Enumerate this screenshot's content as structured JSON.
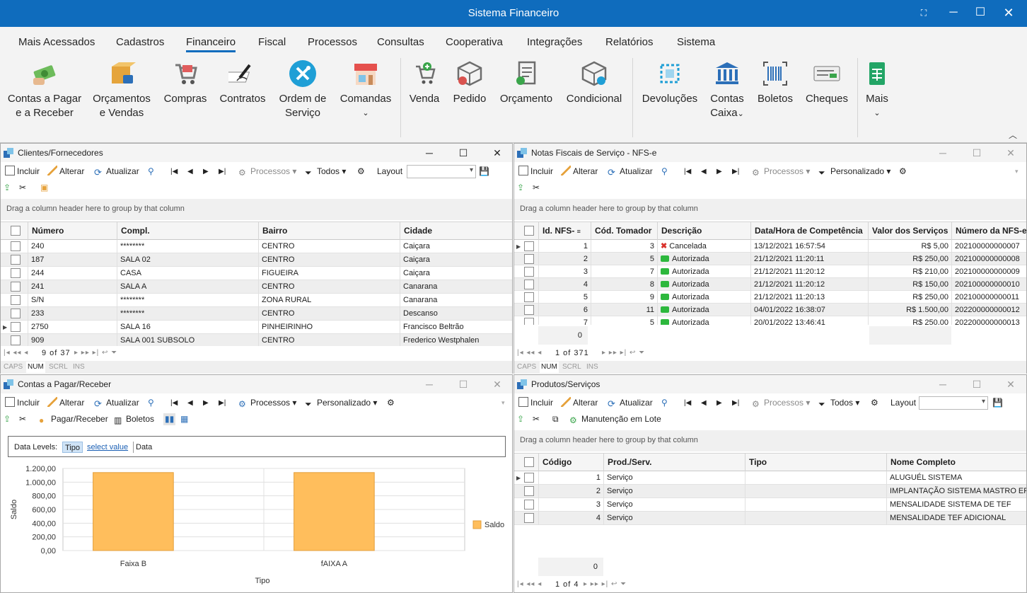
{
  "window": {
    "title": "Sistema Financeiro"
  },
  "ribbon": {
    "tabs": [
      "Mais Acessados",
      "Cadastros",
      "Financeiro",
      "Fiscal",
      "Processos",
      "Consultas",
      "Cooperativa",
      "Integrações",
      "Relatórios",
      "Sistema"
    ],
    "active_tab": "Financeiro",
    "buttons": [
      {
        "line1": "Contas a Pagar",
        "line2": "e a Receber",
        "icon": "money-icon"
      },
      {
        "line1": "Orçamentos",
        "line2": "e Vendas",
        "icon": "box-icon"
      },
      {
        "line1": "Compras",
        "line2": "",
        "icon": "cart-icon"
      },
      {
        "line1": "Contratos",
        "line2": "",
        "icon": "contract-icon"
      },
      {
        "line1": "Ordem de",
        "line2": "Serviço",
        "icon": "tools-icon"
      },
      {
        "line1": "Comandas",
        "line2": "",
        "icon": "store-icon"
      },
      {
        "line1": "Venda",
        "line2": "",
        "icon": "cart-add-icon"
      },
      {
        "line1": "Pedido",
        "line2": "",
        "icon": "package-icon"
      },
      {
        "line1": "Orçamento",
        "line2": "",
        "icon": "receipt-icon"
      },
      {
        "line1": "Condicional",
        "line2": "",
        "icon": "package-refresh-icon"
      },
      {
        "line1": "Devoluções",
        "line2": "",
        "icon": "return-icon"
      },
      {
        "line1": "Contas",
        "line2": "Caixa",
        "icon": "bank-icon"
      },
      {
        "line1": "Boletos",
        "line2": "",
        "icon": "barcode-icon"
      },
      {
        "line1": "Cheques",
        "line2": "",
        "icon": "check-icon"
      },
      {
        "line1": "Mais",
        "line2": "",
        "icon": "sheet-icon"
      }
    ]
  },
  "panel_clientes": {
    "title": "Clientes/Fornecedores",
    "toolbar": {
      "incluir": "Incluir",
      "alterar": "Alterar",
      "atualizar": "Atualizar",
      "processos": "Processos",
      "filtro": "Todos",
      "layout": "Layout"
    },
    "group_hint": "Drag a column header here to group by that column",
    "columns": [
      "Número",
      "Compl.",
      "Bairro",
      "Cidade"
    ],
    "rows": [
      [
        "240",
        "********",
        "CENTRO",
        "Caiçara"
      ],
      [
        "187",
        "SALA 02",
        "CENTRO",
        "Caiçara"
      ],
      [
        "244",
        "CASA",
        "FIGUEIRA",
        "Caiçara"
      ],
      [
        "241",
        "SALA A",
        "CENTRO",
        "Canarana"
      ],
      [
        "S/N",
        "********",
        "ZONA RURAL",
        "Canarana"
      ],
      [
        "233",
        "********",
        "CENTRO",
        "Descanso"
      ],
      [
        "2750",
        "SALA 16",
        "PINHEIRINHO",
        "Francisco Beltrão"
      ],
      [
        "909",
        "SALA 001 SUBSOLO",
        "CENTRO",
        "Frederico Westphalen"
      ]
    ],
    "pager": "9 of 37",
    "status": [
      "CAPS",
      "NUM",
      "SCRL",
      "INS"
    ]
  },
  "panel_nfse": {
    "title": "Notas Fiscais de Serviço - NFS-e",
    "toolbar": {
      "incluir": "Incluir",
      "alterar": "Alterar",
      "atualizar": "Atualizar",
      "processos": "Processos",
      "filtro": "Personalizado"
    },
    "group_hint": "Drag a column header here to group by that column",
    "columns": [
      "Id. NFS-",
      "Cód. Tomador",
      "Descrição",
      "Data/Hora de Competência",
      "Valor dos Serviços",
      "Número da NFS-e"
    ],
    "rows": [
      [
        "1",
        "3",
        "Cancelada",
        "13/12/2021 16:57:54",
        "R$ 5,00",
        "202100000000007"
      ],
      [
        "2",
        "5",
        "Autorizada",
        "21/12/2021 11:20:11",
        "R$ 250,00",
        "202100000000008"
      ],
      [
        "3",
        "7",
        "Autorizada",
        "21/12/2021 11:20:12",
        "R$ 210,00",
        "202100000000009"
      ],
      [
        "4",
        "8",
        "Autorizada",
        "21/12/2021 11:20:12",
        "R$ 150,00",
        "202100000000010"
      ],
      [
        "5",
        "9",
        "Autorizada",
        "21/12/2021 11:20:13",
        "R$ 250,00",
        "202100000000011"
      ],
      [
        "6",
        "11",
        "Autorizada",
        "04/01/2022 16:38:07",
        "R$ 1.500,00",
        "202200000000012"
      ],
      [
        "7",
        "5",
        "Autorizada",
        "20/01/2022 13:46:41",
        "R$ 250,00",
        "202200000000013"
      ]
    ],
    "footer_count": "0",
    "pager": "1 of 371",
    "status": [
      "CAPS",
      "NUM",
      "SCRL",
      "INS"
    ]
  },
  "panel_contas": {
    "title": "Contas a Pagar/Receber",
    "toolbar": {
      "incluir": "Incluir",
      "alterar": "Alterar",
      "atualizar": "Atualizar",
      "processos": "Processos",
      "filtro": "Personalizado",
      "pagar": "Pagar/Receber",
      "boletos": "Boletos"
    },
    "data_levels": {
      "label": "Data Levels:",
      "tipo": "Tipo",
      "select": "select value",
      "data": "Data"
    }
  },
  "panel_produtos": {
    "title": "Produtos/Serviços",
    "toolbar": {
      "incluir": "Incluir",
      "alterar": "Alterar",
      "atualizar": "Atualizar",
      "processos": "Processos",
      "filtro": "Todos",
      "layout": "Layout",
      "lote": "Manutenção em Lote"
    },
    "group_hint": "Drag a column header here to group by that column",
    "columns": [
      "Código",
      "Prod./Serv.",
      "Tipo",
      "Nome Completo"
    ],
    "rows": [
      [
        "1",
        "Serviço",
        "",
        "ALUGUÉL SISTEMA"
      ],
      [
        "2",
        "Serviço",
        "",
        "IMPLANTAÇÃO SISTEMA MASTRO ERP"
      ],
      [
        "3",
        "Serviço",
        "",
        "MENSALIDADE SISTEMA DE TEF"
      ],
      [
        "4",
        "Serviço",
        "",
        "MENSALIDADE TEF ADICIONAL"
      ]
    ],
    "footer_count": "0",
    "pager": "1 of 4"
  },
  "chart_data": {
    "type": "bar",
    "categories": [
      "Faixa B",
      "fAIXA A"
    ],
    "series": [
      {
        "name": "Saldo",
        "values": [
          1140,
          1140
        ]
      }
    ],
    "xlabel": "Tipo",
    "ylabel": "Saldo",
    "ylim": [
      0,
      1200
    ],
    "yticks": [
      "0,00",
      "200,00",
      "400,00",
      "600,00",
      "800,00",
      "1.000,00",
      "1.200,00"
    ],
    "color": "#ffbe5c",
    "legend": "right"
  }
}
